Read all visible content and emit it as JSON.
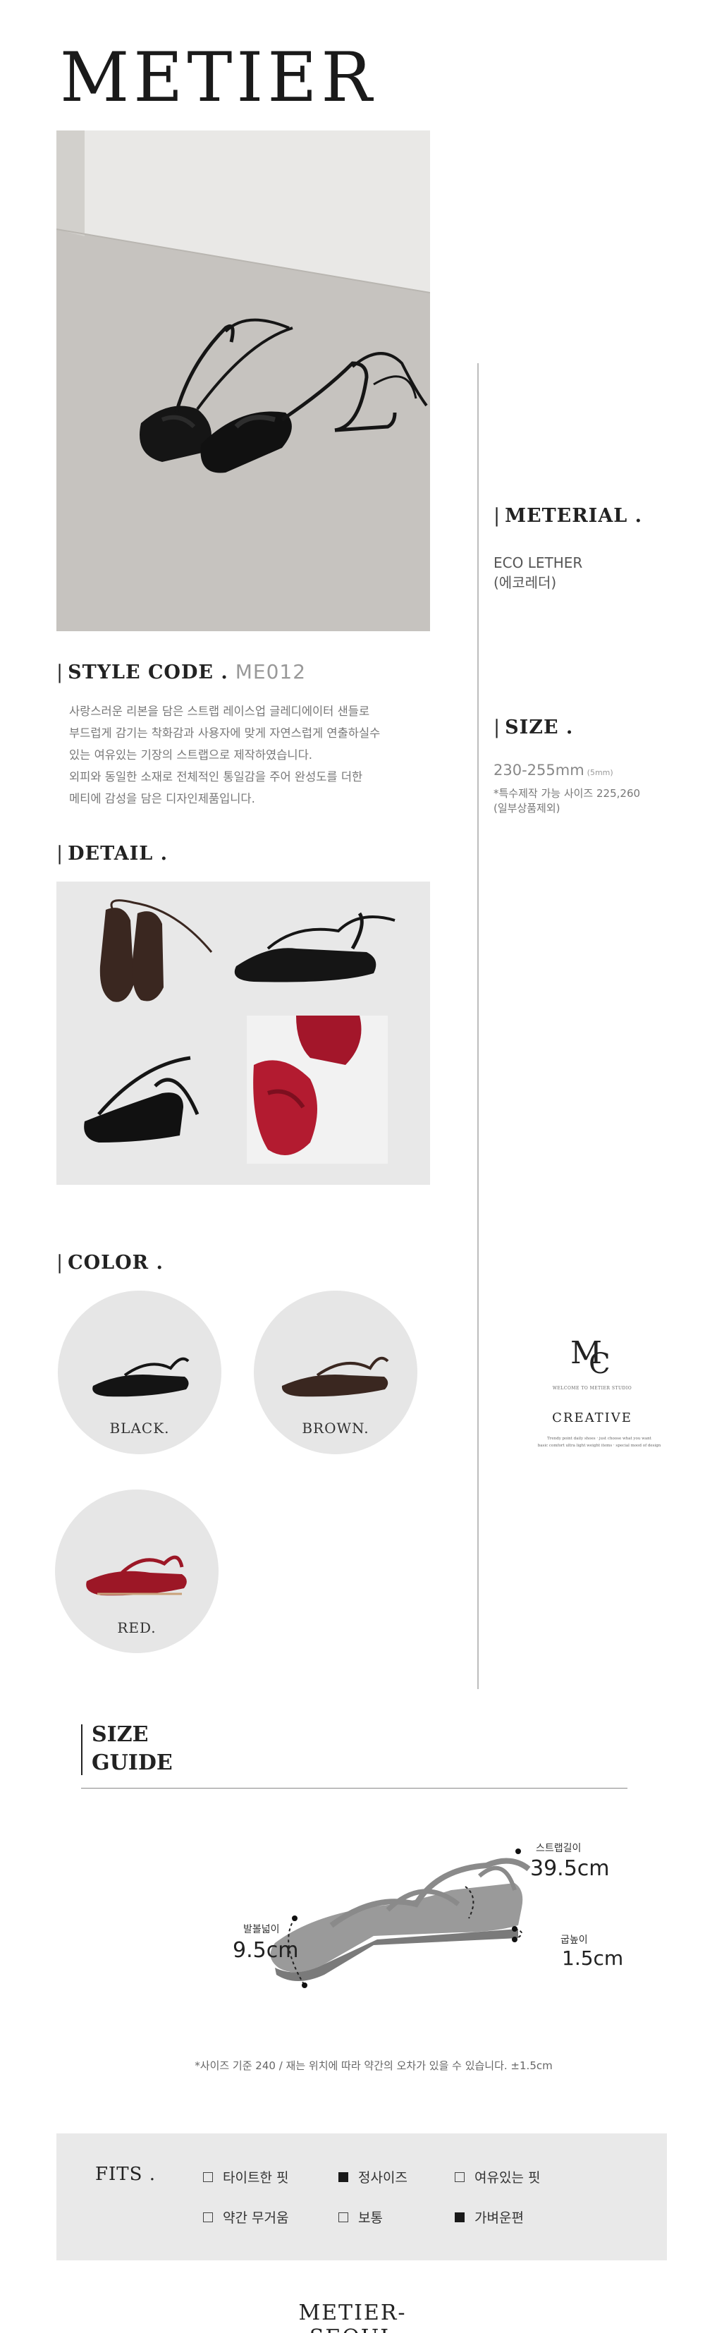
{
  "brand": {
    "name": "METIER"
  },
  "material": {
    "heading": "METERIAL .",
    "text": "ECO LETHER\n(에코레더)"
  },
  "size": {
    "heading": "SIZE .",
    "range": "230-255mm",
    "unit_note": "(5mm)",
    "note": "*특수제작 가능 사이즈 225,260\n(일부상품제외)"
  },
  "style": {
    "heading": "STYLE CODE .",
    "code": "ME012",
    "description": "사랑스러운 리본을 담은 스트랩 레이스업 글레디에이터 샌들로\n부드럽게 감기는 착화감과 사용자에 맞게 자연스럽게 연출하실수\n있는 여유있는 기장의 스트랩으로 제작하였습니다.\n외피와 동일한 소재로 전체적인 통일감을 주어 완성도를 더한\n메티에 감성을 담은 디자인제품입니다."
  },
  "detail": {
    "heading": "DETAIL ."
  },
  "color": {
    "heading": "COLOR .",
    "options": [
      {
        "label": "BLACK.",
        "hex": "#141414"
      },
      {
        "label": "BROWN.",
        "hex": "#3a2720"
      },
      {
        "label": "RED.",
        "hex": "#9c1726"
      }
    ]
  },
  "creative": {
    "monogram": "MC",
    "welcome": "WELCOME TO METIER STUDIO",
    "title": "CREATIVE",
    "subtitle": "Trendy point daily shoes · just choose what you want\nbasic comfort ultra light weight items · special mood of design"
  },
  "size_guide": {
    "title": "SIZE\nGUIDE",
    "strap_label": "스트랩길이",
    "strap_value": "39.5cm",
    "width_label": "발볼넓이",
    "width_value": "9.5cm",
    "heel_label": "굽높이",
    "heel_value": "1.5cm",
    "note": "*사이즈 기준 240 / 재는 위치에 따라 약간의 오차가 있을 수 있습니다. ±1.5cm"
  },
  "fits": {
    "title": "FITS .",
    "options": [
      {
        "label": "타이트한 핏",
        "checked": false
      },
      {
        "label": "정사이즈",
        "checked": true
      },
      {
        "label": "여유있는 핏",
        "checked": false
      },
      {
        "label": "약간 무거움",
        "checked": false
      },
      {
        "label": "보통",
        "checked": false
      },
      {
        "label": "가벼운편",
        "checked": true
      }
    ]
  },
  "footer": {
    "brand": "METIER-SEOUL"
  }
}
